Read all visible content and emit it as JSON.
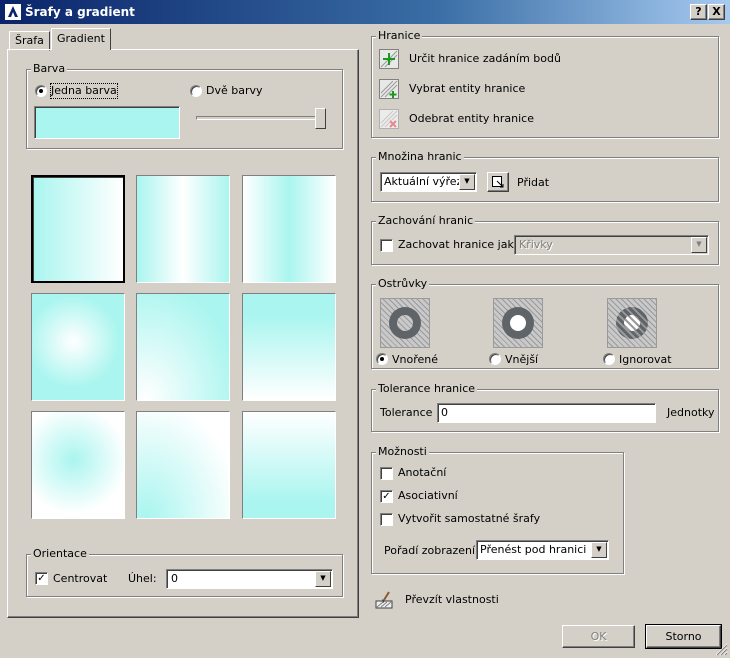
{
  "window": {
    "title": "Šrafy a gradient",
    "help_label": "?",
    "close_label": "X"
  },
  "tabs": [
    {
      "label": "Šrafa"
    },
    {
      "label": "Gradient"
    }
  ],
  "barva": {
    "label": "Barva",
    "option_one": "Jedna barva",
    "option_two": "Dvě barvy",
    "selected": "Jedna barva",
    "color": "#aaf5ef"
  },
  "gradients": [
    "linear",
    "cylinder",
    "inv-cylinder",
    "spherical",
    "hemispherical",
    "curved",
    "inv-spherical",
    "inv-hemispherical",
    "inv-curved"
  ],
  "orientace": {
    "label": "Orientace",
    "center_label": "Centrovat",
    "center_checked": true,
    "angle_label": "Úhel:",
    "angle_value": "0"
  },
  "hranice": {
    "label": "Hranice",
    "pick_points": "Určit hranice zadáním bodů",
    "select_entities": "Vybrat entity hranice",
    "remove_entities": "Odebrat entity hranice"
  },
  "mnozina": {
    "label": "Množina hranic",
    "value": "Aktuální výřez",
    "add_label": "Přidat"
  },
  "zachovani": {
    "label": "Zachování hranic",
    "retain_label": "Zachovat hranice jako",
    "retain_checked": false,
    "type_value": "Křivky"
  },
  "ostruvky": {
    "label": "Ostrůvky",
    "options": [
      "Vnořené",
      "Vnější",
      "Ignorovat"
    ],
    "selected": "Vnořené"
  },
  "tolerance": {
    "group_label": "Tolerance hranice",
    "label": "Tolerance",
    "value": "0",
    "unit": "Jednotky"
  },
  "moznosti": {
    "label": "Možnosti",
    "annotative": "Anotační",
    "annotative_checked": false,
    "associative": "Asociativní",
    "associative_checked": true,
    "separate": "Vytvořit samostatné šrafy",
    "separate_checked": false,
    "draw_order_label": "Pořadí zobrazení",
    "draw_order_value": "Přenést pod hranici"
  },
  "inherit": {
    "label": "Převzít vlastnosti"
  },
  "footer": {
    "ok_label": "OK",
    "cancel_label": "Storno"
  },
  "colors": {
    "titlebar": "#0a246a",
    "face": "#d4d0c8",
    "gradient_color": "#aaf5ef"
  }
}
